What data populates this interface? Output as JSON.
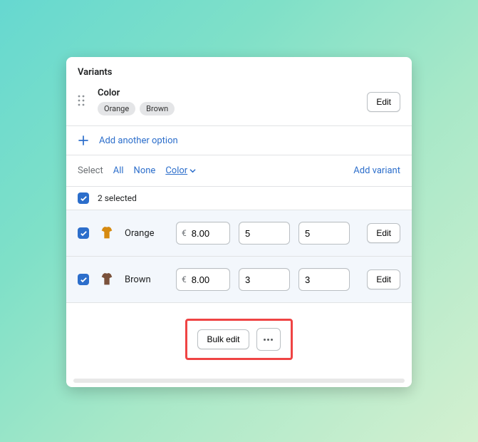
{
  "panel": {
    "title": "Variants"
  },
  "option": {
    "name": "Color",
    "values": [
      "Orange",
      "Brown"
    ],
    "edit_label": "Edit"
  },
  "add_option": {
    "label": "Add another option"
  },
  "filters": {
    "select": "Select",
    "all": "All",
    "none": "None",
    "group": "Color",
    "add_variant": "Add variant"
  },
  "selected_summary": "2 selected",
  "columns": {
    "currency": "€"
  },
  "variants": [
    {
      "name": "Orange",
      "swatch": "#d68a10",
      "price": "8.00",
      "qty1": "5",
      "qty2": "5",
      "edit_label": "Edit"
    },
    {
      "name": "Brown",
      "swatch": "#7a513b",
      "price": "8.00",
      "qty1": "3",
      "qty2": "3",
      "edit_label": "Edit"
    }
  ],
  "actions": {
    "bulk_edit": "Bulk edit"
  }
}
